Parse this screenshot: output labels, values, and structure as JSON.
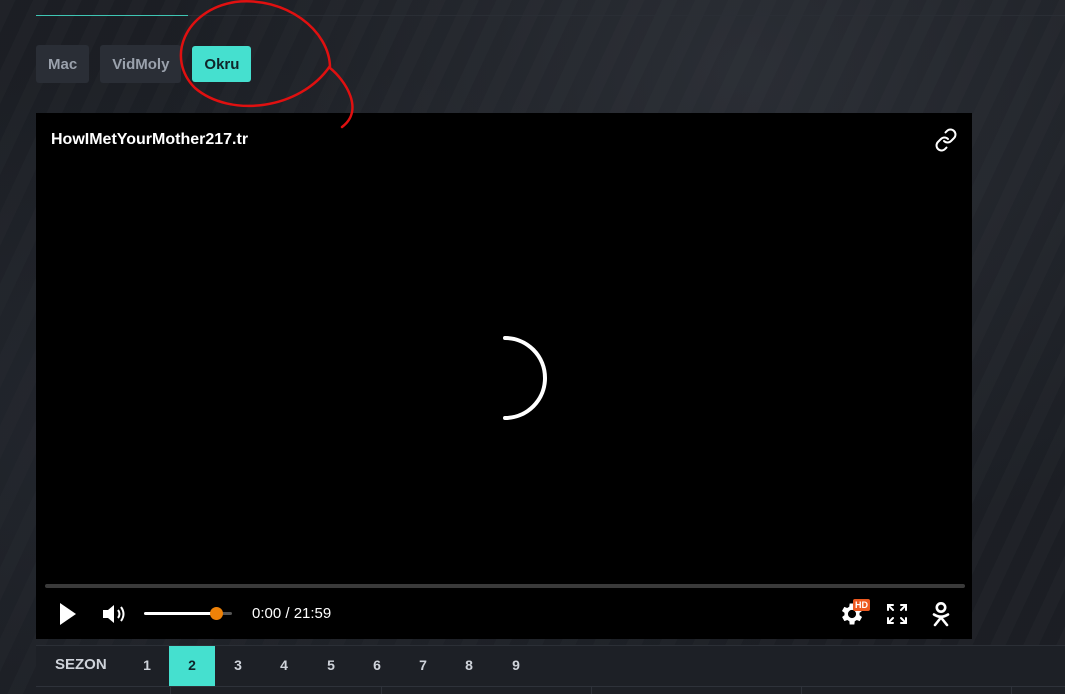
{
  "source_tabs": [
    {
      "label": "Mac",
      "active": false
    },
    {
      "label": "VidMoly",
      "active": false
    },
    {
      "label": "Okru",
      "active": true
    }
  ],
  "player": {
    "title": "HowIMetYourMother217.tr",
    "time": "0:00 / 21:59",
    "volume_level": 0.83,
    "progress": 0,
    "hd_badge": "HD",
    "accent_color": "#ee8208"
  },
  "seasons": {
    "label": "SEZON",
    "items": [
      "1",
      "2",
      "3",
      "4",
      "5",
      "6",
      "7",
      "8",
      "9"
    ],
    "active": "2",
    "accent_color": "#45e0cf"
  },
  "icons": {
    "link": "link-icon",
    "play": "play-icon",
    "volume": "volume-icon",
    "settings": "gear-icon",
    "fullscreen": "fullscreen-icon",
    "ok": "odnoklassniki-icon",
    "spinner": "loading-spinner-icon"
  }
}
